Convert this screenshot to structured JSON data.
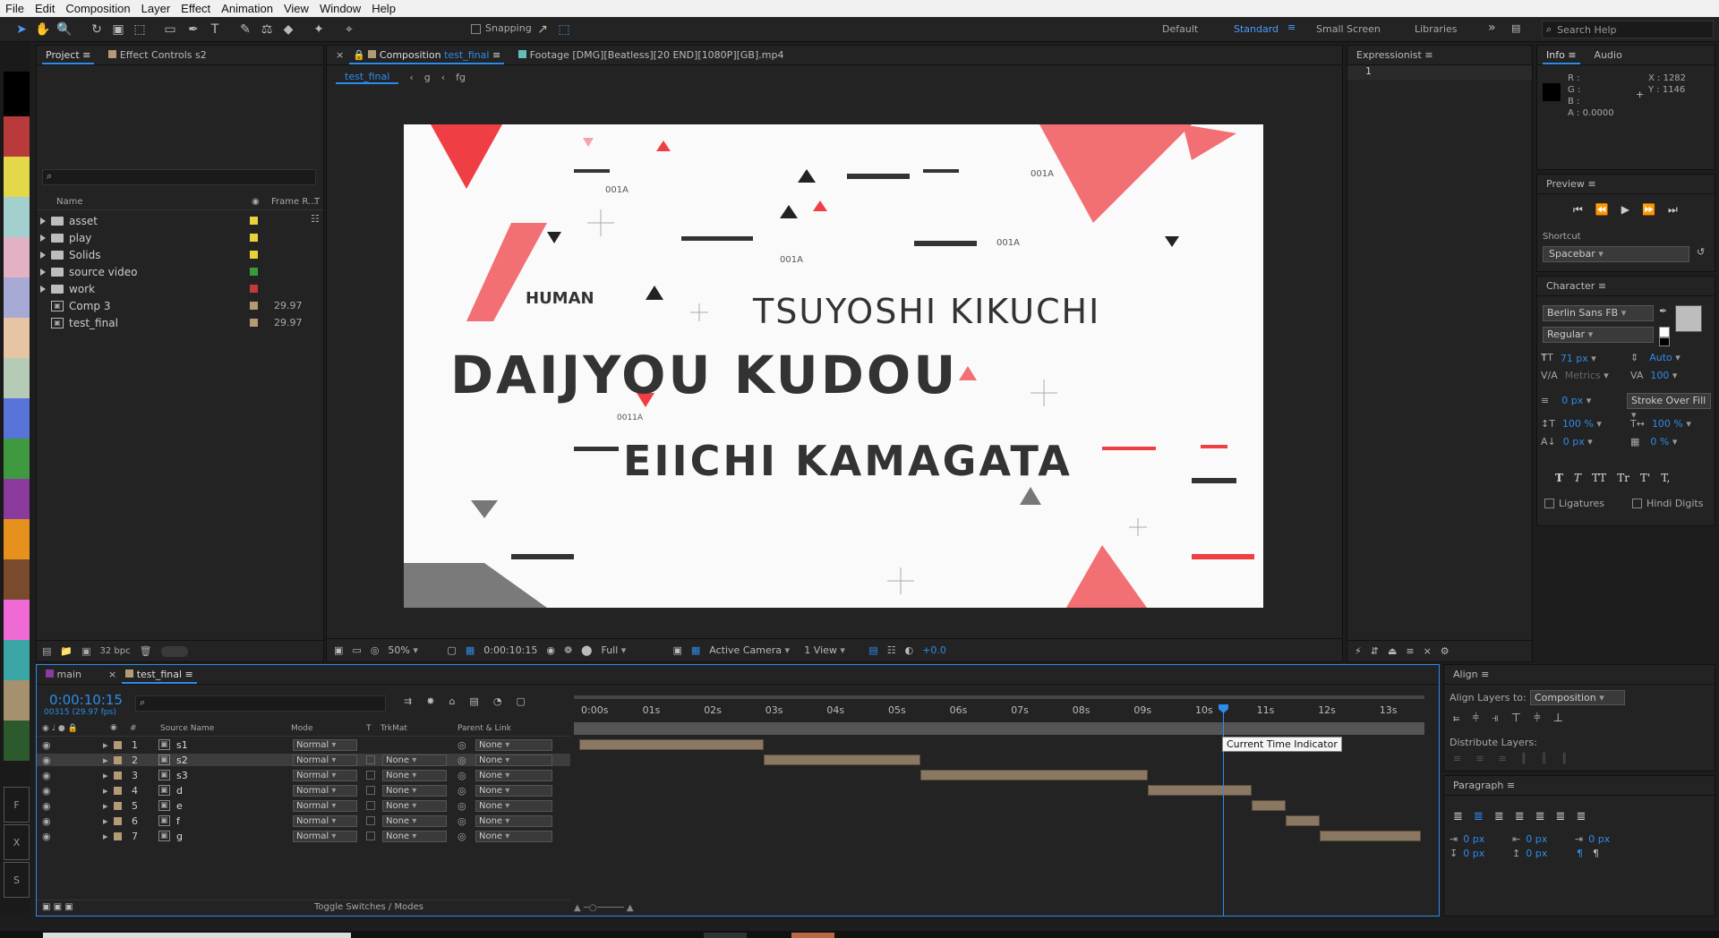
{
  "menu": [
    "File",
    "Edit",
    "Composition",
    "Layer",
    "Effect",
    "Animation",
    "View",
    "Window",
    "Help"
  ],
  "toolbar": {
    "snapping": "Snapping",
    "workspaces": [
      "Default",
      "Standard",
      "Small Screen",
      "Libraries"
    ],
    "search_placeholder": "Search Help"
  },
  "project": {
    "tabs": [
      "Project",
      "Effect Controls s2"
    ],
    "columns": [
      "Name",
      "Frame R...",
      "T"
    ],
    "items": [
      {
        "name": "asset",
        "type": "folder",
        "color": "#e8d33b",
        "rate": ""
      },
      {
        "name": "play",
        "type": "folder",
        "color": "#e8d33b",
        "rate": ""
      },
      {
        "name": "Solids",
        "type": "folder",
        "color": "#e8d33b",
        "rate": ""
      },
      {
        "name": "source video",
        "type": "folder",
        "color": "#3a9a3a",
        "rate": ""
      },
      {
        "name": "work",
        "type": "folder",
        "color": "#c33a3a",
        "rate": ""
      },
      {
        "name": "Comp 3",
        "type": "comp",
        "color": "#b39b73",
        "rate": "29.97"
      },
      {
        "name": "test_final",
        "type": "comp",
        "color": "#b39b73",
        "rate": "29.97"
      }
    ],
    "bpc": "32 bpc"
  },
  "composition": {
    "tab_prefix": "Composition",
    "tab_name": "test_final",
    "footage_tab": "Footage  [DMG][Beatless][20 END][1080P][GB].mp4",
    "breadcrumb": [
      "test_final",
      "g",
      "fg"
    ],
    "canvas": {
      "human": "HUMAN",
      "name1": "TSUYOSHI KIKUCHI",
      "name2": "DAIJYOU KUDOU",
      "name3": "EIICHI KAMAGATA",
      "codes": [
        "001A",
        "001A",
        "001A",
        "001A",
        "0011A"
      ]
    },
    "footer": {
      "zoom": "50%",
      "time": "0:00:10:15",
      "resolution": "Full",
      "camera": "Active Camera",
      "views": "1 View",
      "exposure": "+0.0"
    }
  },
  "expressionist": {
    "title": "Expressionist",
    "line": "1"
  },
  "info": {
    "tabs": [
      "Info",
      "Audio"
    ],
    "r": "R :",
    "g": "G :",
    "b": "B :",
    "a": "A : 0.0000",
    "x": "X : 1282",
    "y": "Y : 1146"
  },
  "preview": {
    "title": "Preview",
    "shortcut_label": "Shortcut",
    "shortcut": "Spacebar"
  },
  "character": {
    "title": "Character",
    "font": "Berlin Sans FB",
    "style": "Regular",
    "size": "71 px",
    "leading": "Auto",
    "kerning": "Metrics",
    "tracking": "100",
    "stroke": "0 px",
    "stroke_mode": "Stroke Over Fill",
    "vscale": "100 %",
    "hscale": "100 %",
    "baseline": "0 px",
    "tsume": "0 %",
    "styles": [
      "T",
      "T",
      "TT",
      "Tr",
      "T'",
      "T,"
    ],
    "ligatures": "Ligatures",
    "hindi": "Hindi Digits"
  },
  "timeline": {
    "tabs": [
      "main",
      "test_final"
    ],
    "timecode": "0:00:10:15",
    "frames": "00315 (29.97 fps)",
    "columns": [
      "#",
      "Source Name",
      "Mode",
      "T",
      "TrkMat",
      "Parent & Link"
    ],
    "layers": [
      {
        "n": "1",
        "name": "s1",
        "mode": "Normal",
        "trk": "",
        "parent": "None"
      },
      {
        "n": "2",
        "name": "s2",
        "mode": "Normal",
        "trk": "None",
        "parent": "None"
      },
      {
        "n": "3",
        "name": "s3",
        "mode": "Normal",
        "trk": "None",
        "parent": "None"
      },
      {
        "n": "4",
        "name": "d",
        "mode": "Normal",
        "trk": "None",
        "parent": "None"
      },
      {
        "n": "5",
        "name": "e",
        "mode": "Normal",
        "trk": "None",
        "parent": "None"
      },
      {
        "n": "6",
        "name": "f",
        "mode": "Normal",
        "trk": "None",
        "parent": "None"
      },
      {
        "n": "7",
        "name": "g",
        "mode": "Normal",
        "trk": "None",
        "parent": "None"
      }
    ],
    "ruler": [
      "0:00s",
      "01s",
      "02s",
      "03s",
      "04s",
      "05s",
      "06s",
      "07s",
      "08s",
      "09s",
      "10s",
      "11s",
      "12s",
      "13s"
    ],
    "tooltip": "Current Time Indicator",
    "toggle": "Toggle Switches / Modes"
  },
  "align": {
    "title": "Align",
    "align_to_label": "Align Layers to:",
    "align_to": "Composition",
    "distribute": "Distribute Layers:"
  },
  "paragraph": {
    "title": "Paragraph",
    "indent": "0 px",
    "space": "0 px"
  }
}
